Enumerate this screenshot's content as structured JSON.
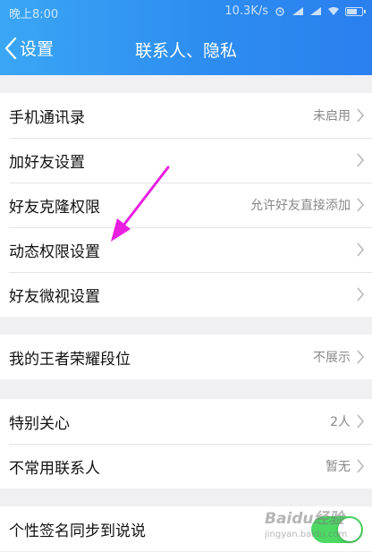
{
  "status_bar": {
    "time": "晚上8:00",
    "network_speed": "10.3K/s"
  },
  "nav": {
    "back_label": "设置",
    "title": "联系人、隐私"
  },
  "sections": [
    {
      "rows": [
        {
          "label": "手机通讯录",
          "value": "未启用"
        },
        {
          "label": "加好友设置",
          "value": ""
        },
        {
          "label": "好友克隆权限",
          "value": "允许好友直接添加"
        },
        {
          "label": "动态权限设置",
          "value": ""
        },
        {
          "label": "好友微视设置",
          "value": ""
        }
      ]
    },
    {
      "rows": [
        {
          "label": "我的王者荣耀段位",
          "value": "不展示"
        }
      ]
    },
    {
      "rows": [
        {
          "label": "特别关心",
          "value": "2人"
        },
        {
          "label": "不常用联系人",
          "value": "暂无"
        }
      ]
    },
    {
      "rows": [
        {
          "label": "个性签名同步到说说",
          "toggle_on": true
        }
      ]
    }
  ],
  "watermark": {
    "main": "Baidu经验",
    "sub": "jingyan.baidu.com"
  },
  "colors": {
    "header_start": "#3aa6f4",
    "header_end": "#2b7fef",
    "toggle_on": "#4cd964",
    "annotation_arrow": "#e81fe0"
  }
}
